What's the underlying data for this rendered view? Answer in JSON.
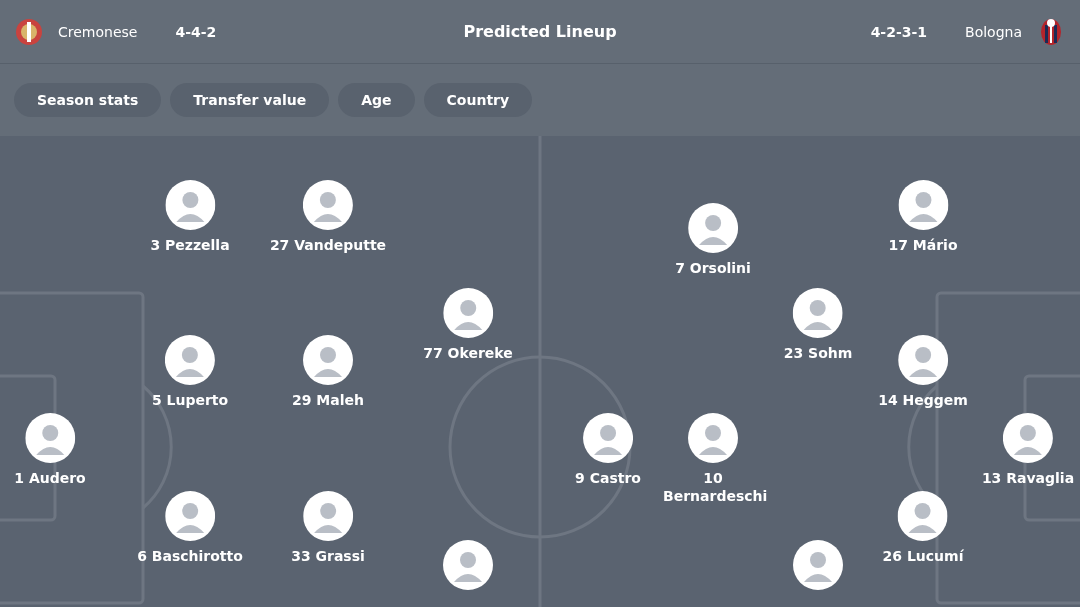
{
  "header": {
    "title": "Predicted Lineup",
    "home": {
      "name": "Cremonese",
      "formation": "4-4-2"
    },
    "away": {
      "formation": "4-2-3-1",
      "name": "Bologna"
    }
  },
  "filters": [
    {
      "label": "Season stats"
    },
    {
      "label": "Transfer value"
    },
    {
      "label": "Age"
    },
    {
      "label": "Country"
    }
  ],
  "home_columns": [
    [
      {
        "label": "1 Audero"
      }
    ],
    [
      {
        "label": "3 Pezzella"
      },
      {
        "label": "5 Luperto"
      },
      {
        "label": "6 Baschirotto"
      }
    ],
    [
      {
        "label": "27 Vandeputte"
      },
      {
        "label": "29 Maleh"
      },
      {
        "label": "33 Grassi"
      }
    ],
    [
      {
        "label": "77 Okereke"
      },
      {}
    ]
  ],
  "away_columns": [
    [
      {
        "label": "13 Ravaglia"
      }
    ],
    [
      {
        "label": "17 Mário"
      },
      {
        "label": "14 Heggem"
      },
      {
        "label": "26 Lucumí"
      }
    ],
    [
      {
        "label": "23 Sohm"
      },
      {}
    ],
    [
      {
        "label": "7 Orsolini"
      },
      {
        "label": "10 Bernardeschi"
      }
    ],
    [
      {
        "label": "9 Castro"
      }
    ]
  ]
}
